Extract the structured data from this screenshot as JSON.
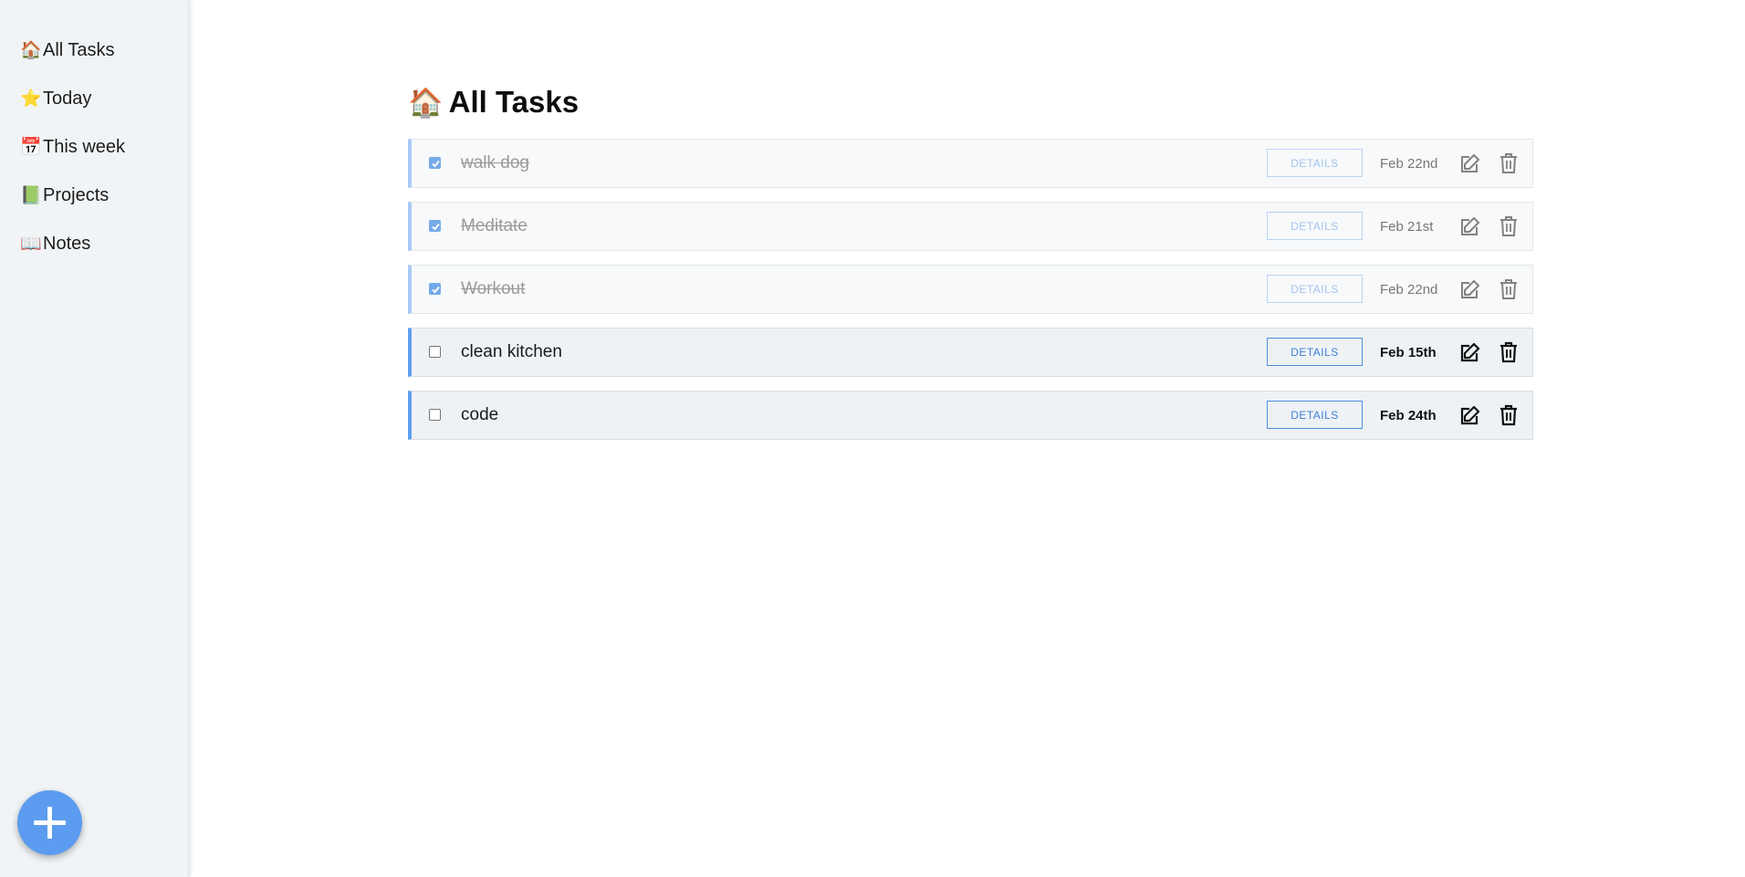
{
  "sidebar": {
    "items": [
      {
        "icon": "🏠",
        "icon_name": "house-icon",
        "label": "All Tasks"
      },
      {
        "icon": "⭐",
        "icon_name": "star-icon",
        "label": "Today"
      },
      {
        "icon": "📅",
        "icon_name": "calendar-icon",
        "label": "This week"
      },
      {
        "icon": "📗",
        "icon_name": "green-book-icon",
        "label": "Projects"
      },
      {
        "icon": "📖",
        "icon_name": "open-book-icon",
        "label": "Notes"
      }
    ],
    "add_button_icon": "plus-icon"
  },
  "main": {
    "title_icon": "🏠",
    "title": "All Tasks",
    "tasks": [
      {
        "name": "walk dog",
        "done": true,
        "details_label": "DETAILS",
        "date": "Feb 22nd"
      },
      {
        "name": "Meditate",
        "done": true,
        "details_label": "DETAILS",
        "date": "Feb 21st"
      },
      {
        "name": "Workout",
        "done": true,
        "details_label": "DETAILS",
        "date": "Feb 22nd"
      },
      {
        "name": "clean kitchen",
        "done": false,
        "details_label": "DETAILS",
        "date": "Feb 15th"
      },
      {
        "name": "code",
        "done": false,
        "details_label": "DETAILS",
        "date": "Feb 24th"
      }
    ]
  },
  "colors": {
    "accent": "#5b9cf0",
    "sidebar_bg": "#f1f4f6",
    "row_border_active": "#5f9ff0",
    "row_border_done": "#a9caf5"
  }
}
